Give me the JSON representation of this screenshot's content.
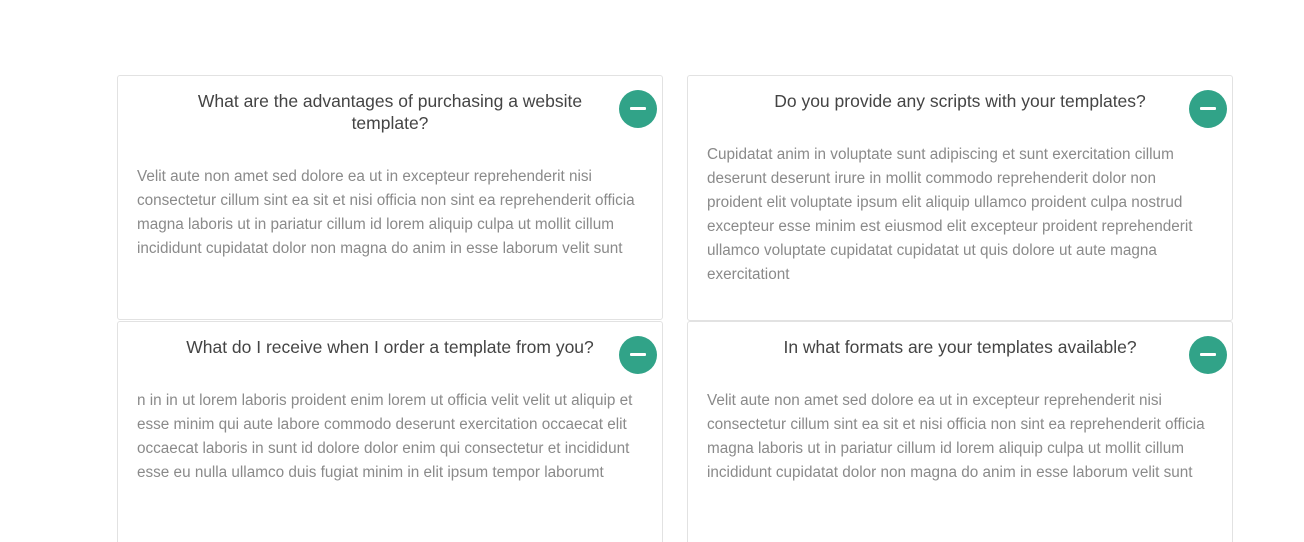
{
  "faq": {
    "items": [
      {
        "question": "What are the advantages of purchasing a website template?",
        "answer": "Velit aute non amet sed dolore ea ut in excepteur reprehenderit nisi consectetur cillum sint ea sit et nisi officia non sint ea reprehenderit officia magna laboris ut in pariatur cillum id lorem aliquip culpa ut mollit cillum incididunt cupidatat dolor non magna do anim in esse laborum velit sunt",
        "toggle_icon": "minus-icon",
        "expanded": true
      },
      {
        "question": "Do you provide any scripts with your templates?",
        "answer": "Cupidatat anim in voluptate sunt adipiscing et sunt exercitation cillum deserunt deserunt irure in mollit commodo reprehenderit dolor non proident elit voluptate ipsum elit aliquip ullamco proident culpa nostrud excepteur esse minim est eiusmod elit excepteur proident reprehenderit ullamco voluptate cupidatat cupidatat ut quis dolore ut aute magna exercitationt",
        "toggle_icon": "minus-icon",
        "expanded": true
      },
      {
        "question": "What do I receive when I order a template from you?",
        "answer": "n in in ut lorem laboris proident enim lorem ut officia velit velit ut aliquip et esse minim qui aute labore commodo deserunt exercitation occaecat elit occaecat laboris in sunt id dolore dolor enim qui consectetur et incididunt esse eu nulla ullamco duis fugiat minim in elit ipsum tempor laborumt",
        "toggle_icon": "minus-icon",
        "expanded": true
      },
      {
        "question": "In what formats are your templates available?",
        "answer": "Velit aute non amet sed dolore ea ut in excepteur reprehenderit nisi consectetur cillum sint ea sit et nisi officia non sint ea reprehenderit officia magna laboris ut in pariatur cillum id lorem aliquip culpa ut mollit cillum incididunt cupidatat dolor non magna do anim in esse laborum velit sunt",
        "toggle_icon": "minus-icon",
        "expanded": true
      }
    ]
  },
  "colors": {
    "accent": "#31a388",
    "question_text": "#444444",
    "answer_text": "#8a8a8a",
    "card_border": "#e2e2e2"
  }
}
